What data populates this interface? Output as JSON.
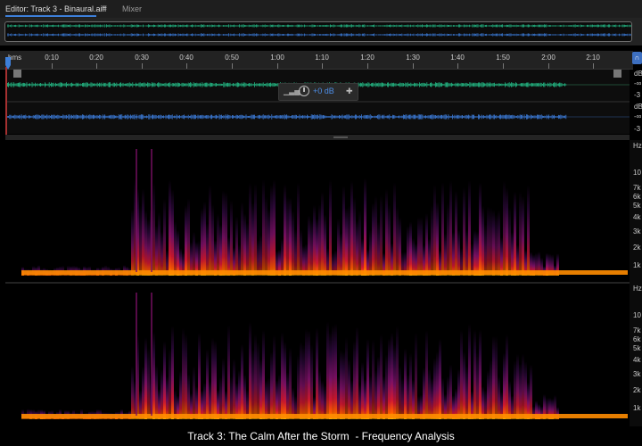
{
  "tabs": {
    "editor_label": "Editor: Track 3 - Binaural.aiff",
    "menu_icon": "hamburger-menu-icon",
    "mixer_label": "Mixer"
  },
  "ruler": {
    "unit": "hms",
    "ticks": [
      "0:10",
      "0:20",
      "0:30",
      "0:40",
      "0:50",
      "1:00",
      "1:10",
      "1:20",
      "1:30",
      "1:40",
      "1:50",
      "2:00",
      "2:10"
    ]
  },
  "waveform": {
    "channel1_color": "#23c08a",
    "channel2_color": "#3d7fe0",
    "db_labels": [
      "dB",
      "-∞",
      "-3",
      "dB",
      "-∞",
      "-3"
    ]
  },
  "hud": {
    "meter_icon": "level-meter-icon",
    "knob_icon": "volume-knob-icon",
    "gain": "+0 dB",
    "pin_icon": "pin-icon"
  },
  "spectral": {
    "hz_labels_top": [
      "Hz",
      "10",
      "7k",
      "6k",
      "5k",
      "4k",
      "3k",
      "2k",
      "1k"
    ],
    "hz_labels_bottom": [
      "Hz",
      "10",
      "7k",
      "6k",
      "5k",
      "4k",
      "3k",
      "2k",
      "1k"
    ]
  },
  "caption": "Track 3: The Calm After the Storm  - Frequency Analysis",
  "colors": {
    "accent": "#3d7fd9",
    "playhead": "#a53030"
  }
}
